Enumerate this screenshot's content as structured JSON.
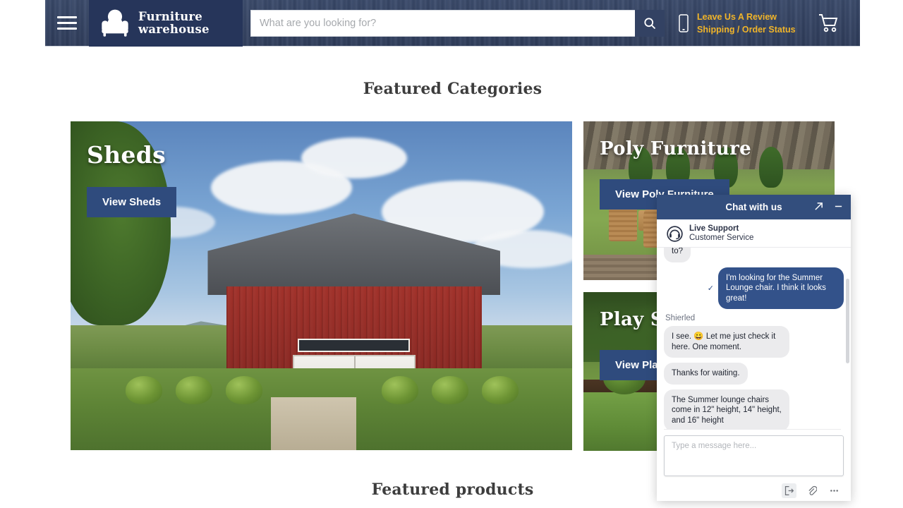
{
  "header": {
    "menu_icon": "hamburger-menu-icon",
    "brand_line1": "Furniture",
    "brand_line2": "warehouse",
    "logo_icon": "armchair-logo-icon",
    "search_placeholder": "What are you looking for?",
    "search_value": "",
    "search_icon": "search-icon",
    "phone_icon": "mobile-phone-icon",
    "review_link": "Leave Us A Review",
    "shipping_link": "Shipping / Order Status",
    "cart_icon": "shopping-cart-icon",
    "accent_color": "#f0b429",
    "bar_color": "#334263"
  },
  "sections": {
    "featured_categories": "Featured Categories",
    "featured_products": "Featured products"
  },
  "categories": [
    {
      "title": "Sheds",
      "button": "View Sheds"
    },
    {
      "title": "Poly Furniture",
      "button": "View Poly Furniture"
    },
    {
      "title": "Play Sets",
      "button": "View Play Sets"
    }
  ],
  "chat": {
    "title": "Chat with us",
    "expand_icon": "expand-arrow-icon",
    "minimize_icon": "minimize-icon",
    "agent_avatar_icon": "headset-agent-avatar-icon",
    "agent_name": "Live Support",
    "agent_role": "Customer Service",
    "sender_label": "Shierled",
    "messages": [
      {
        "from": "agent",
        "text": "to?",
        "clipped": true
      },
      {
        "from": "user",
        "text": "I'm looking for the Summer Lounge chair. I think it looks great!",
        "status_icon": "sent-check-icon"
      },
      {
        "from": "agent",
        "text": "I see. 😀 Let me just check it here. One moment."
      },
      {
        "from": "agent",
        "text": "Thanks for waiting."
      },
      {
        "from": "agent",
        "text": "The Summer lounge chairs come in 12\" height, 14\" height, and 16\" height"
      }
    ],
    "input_placeholder": "Type a message here...",
    "input_value": "",
    "footer_icons": [
      {
        "name": "end-chat-icon",
        "label": "End chat"
      },
      {
        "name": "paperclip-attach-icon",
        "label": "Attach file"
      },
      {
        "name": "more-options-icon",
        "label": "More options"
      }
    ],
    "header_color": "#334e7d",
    "user_bubble_color": "#33528a"
  }
}
